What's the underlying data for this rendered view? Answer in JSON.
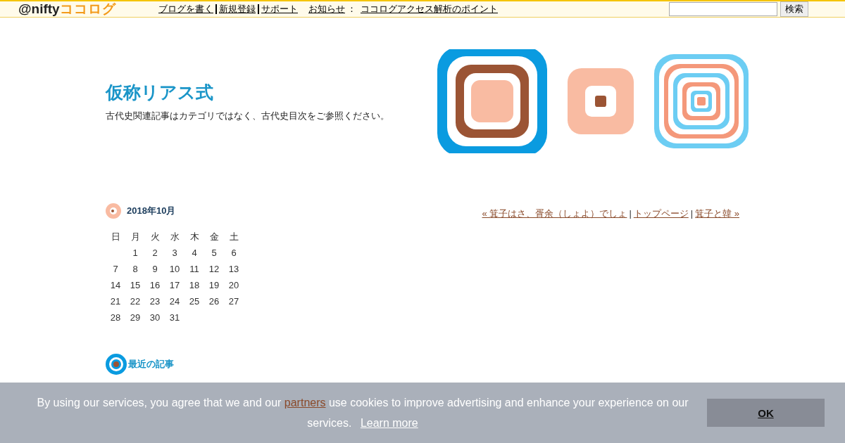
{
  "topbar": {
    "logo_left": "@nifty",
    "logo_right": "ココログ",
    "links": [
      {
        "label": "ブログを書く"
      },
      {
        "label": "新規登録"
      },
      {
        "label": "サポート"
      }
    ],
    "notice_label": "お知らせ",
    "notice_colon": "：",
    "notice_link": "ココログアクセス解析のポイント",
    "search_button": "検索"
  },
  "blog": {
    "title": "仮称リアス式",
    "description": "古代史関連記事はカテゴリではなく、古代史目次をご参照ください。"
  },
  "calendar": {
    "title": "2018年10月",
    "weekdays": [
      "日",
      "月",
      "火",
      "水",
      "木",
      "金",
      "土"
    ],
    "weeks": [
      [
        "1",
        "2",
        "3",
        "4",
        "5",
        "6"
      ],
      [
        "7",
        "8",
        "9",
        "10",
        "11",
        "12",
        "13"
      ],
      [
        "14",
        "15",
        "16",
        "17",
        "18",
        "19",
        "20"
      ],
      [
        "21",
        "22",
        "23",
        "24",
        "25",
        "26",
        "27"
      ],
      [
        "28",
        "29",
        "30",
        "31"
      ]
    ]
  },
  "nav": {
    "prev": "« 箕子はさ、胥余（しょよ）でしょ",
    "top": "トップページ",
    "next": "箕子と韓 »",
    "separator": "|"
  },
  "recent": {
    "title": "最近の記事"
  },
  "cookie": {
    "text_before": "By using our services, you agree that we and our",
    "link": "partners",
    "text_after": "use cookies to improve advertising and enhance your experience on our services.",
    "learn_more": "Learn more",
    "button": "OK"
  }
}
